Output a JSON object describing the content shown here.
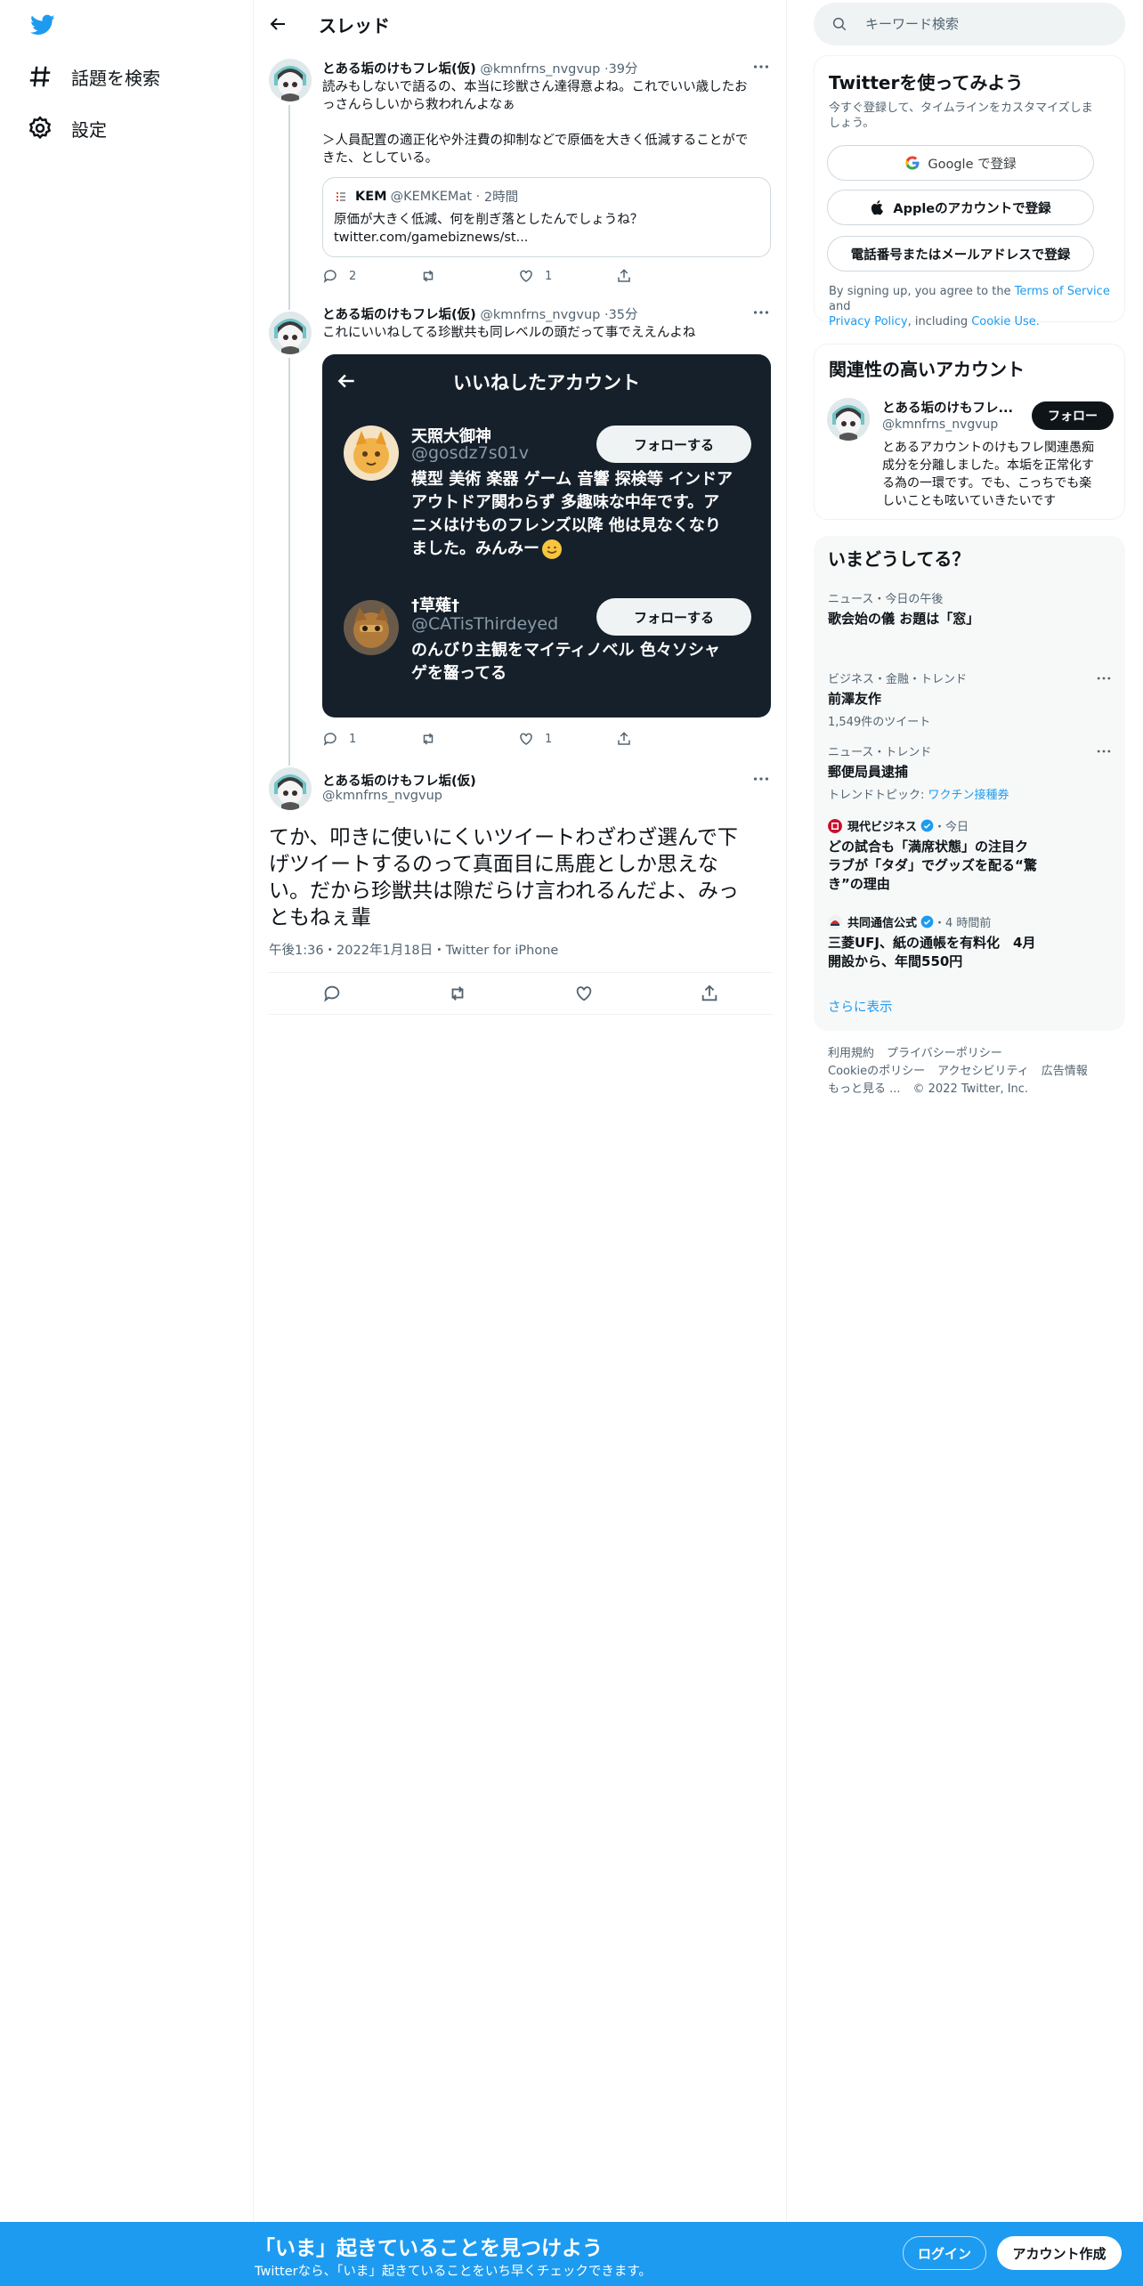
{
  "nav": {
    "items": [
      {
        "label": "話題を検索",
        "icon": "hashtag-icon"
      },
      {
        "label": "設定",
        "icon": "gear-icon"
      }
    ]
  },
  "header": {
    "title": "スレッド"
  },
  "thread": {
    "tweet1": {
      "name": "とある垢のけもフレ垢(仮)",
      "handle": "@kmnfrns_nvgvup",
      "time": "39分",
      "text_lines": [
        "読みもしないで語るの、本当に珍獣さん達得意よね。これでいい歳したお",
        "っさんらしいから救われんよなぁ",
        "",
        "＞人員配置の適正化や外注費の抑制などで原価を大きく低減することがで",
        "きた、としている。"
      ],
      "quote": {
        "name": "KEM",
        "handle": "@KEMKEMat",
        "time": "2時間",
        "text_lines": [
          "原価が大きく低減、何を削ぎ落としたんでしょうね？",
          "twitter.com/gamebiznews/st..."
        ]
      },
      "replies": "2",
      "retweets": "",
      "likes": "1"
    },
    "tweet2": {
      "name": "とある垢のけもフレ垢(仮)",
      "handle": "@kmnfrns_nvgvup",
      "time": "35分",
      "text": "これにいいねしてる珍獣共も同レベルの頭だって事でええんよね",
      "image": {
        "title": "いいねしたアカウント",
        "accounts": [
          {
            "name": "天照大御神",
            "handle": "@gosdz7s01v",
            "bio_lines": [
              "模型 美術 楽器 ゲーム 音響 探検等 インドア",
              "アウトドア関わらず 多趣味な中年です。ア",
              "ニメはけものフレンズ以降 他は見なくなり",
              "ました。みんみー"
            ],
            "follow_label": "フォローする"
          },
          {
            "name": "†草薙†",
            "handle": "@CATisThirdeyed",
            "bio_lines": [
              "のんびり主観をマイティノベル 色々ソシャ",
              "ゲを齧ってる"
            ],
            "follow_label": "フォローする"
          }
        ]
      },
      "replies": "1",
      "retweets": "",
      "likes": "1"
    },
    "focal": {
      "name": "とある垢のけもフレ垢(仮)",
      "handle": "@kmnfrns_nvgvup",
      "text_lines": [
        "てか、叩きに使いにくいツイートわざわざ選んで下",
        "げツイートするのって真面目に馬鹿としか思えな",
        "い。だから珍獣共は隙だらけ言われるんだよ、みっ",
        "ともねぇ輩"
      ],
      "meta": "午後1:36・2022年1月18日・Twitter for iPhone"
    }
  },
  "right": {
    "search_placeholder": "キーワード検索",
    "signup_card": {
      "title": "Twitterを使ってみよう",
      "subtitle_lines": [
        "今すぐ登録して、タイムラインをカスタマイズしま",
        "しょう。"
      ],
      "google_label": "Google で登録",
      "apple_label": "Appleのアカウントで登録",
      "phone_label": "電話番号またはメールアドレスで登録",
      "terms_pre": "By signing up, you agree to the ",
      "terms_link": "Terms of Service",
      "terms_and": " and",
      "privacy_link": "Privacy Policy",
      "terms_including": ", including ",
      "cookie_link": "Cookie Use."
    },
    "related": {
      "title": "関連性の高いアカウント",
      "name": "とある垢のけもフレ...",
      "handle": "@kmnfrns_nvgvup",
      "follow_label": "フォロー",
      "bio_lines": [
        "とあるアカウントのけもフレ関連愚痴",
        "成分を分離しました。本垢を正常化す",
        "る為の一環です。でも、こっちでも楽",
        "しいことも呟いていきたいです"
      ]
    },
    "trends": {
      "title": "いまどうしてる？",
      "items": [
        {
          "category": "ニュース・今日の午後",
          "title": "歌会始の儀 お題は「窓」"
        },
        {
          "category": "ビジネス・金融・トレンド",
          "title": "前澤友作",
          "sub": "1,549件のツイート"
        },
        {
          "category": "ニュース・トレンド",
          "title": "郵便局員逮捕",
          "sub_pre": "トレンドトピック: ",
          "sub_link": "ワクチン接種券"
        },
        {
          "source": "現代ビジネス",
          "time": "・今日",
          "title_lines": [
            "どの試合も「満席状態」の注目ク",
            "ラブが「タダ」でグッズを配る“驚",
            "き”の理由"
          ]
        },
        {
          "source": "共同通信公式",
          "time": "・4 時間前",
          "title_lines": [
            "三菱UFJ、紙の通帳を有料化　4月",
            "開設から、年間550円"
          ]
        }
      ],
      "show_more": "さらに表示"
    },
    "footer": {
      "links": [
        "利用規約",
        "プライバシーポリシー",
        "Cookieのポリシー",
        "アクセシビリティ",
        "広告情報",
        "もっと見る ..."
      ],
      "copyright": "© 2022 Twitter, Inc."
    }
  },
  "bottom": {
    "headline": "「いま」起きていることを見つけよう",
    "sub": "Twitterなら、「いま」起きていることをいち早くチェックできます。",
    "login_label": "ログイン",
    "signup_label": "アカウント作成"
  },
  "colors": {
    "accent": "#1d9bf0",
    "dark_image_bg": "#15202b",
    "text": "#0f1419",
    "secondary": "#536471"
  }
}
